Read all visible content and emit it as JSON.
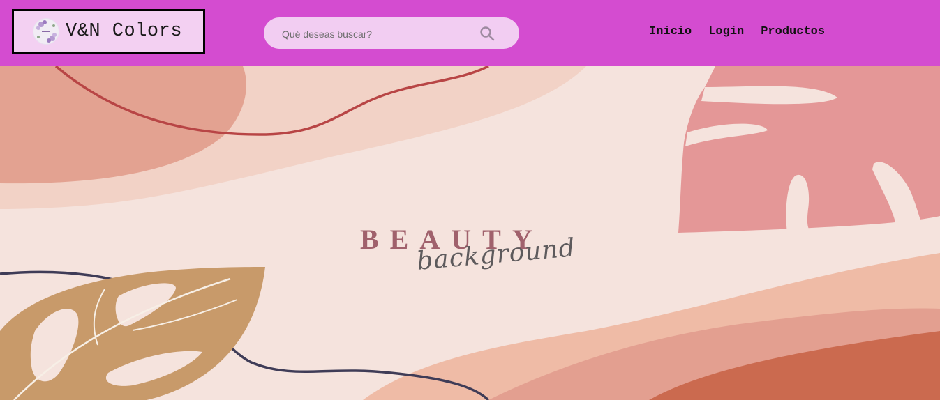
{
  "brand": {
    "name": "V&N Colors",
    "logo_icon": "flower-wreath-logo"
  },
  "search": {
    "placeholder": "Qué deseas buscar?",
    "icon": "search-icon"
  },
  "nav": {
    "items": [
      {
        "label": "Inicio"
      },
      {
        "label": "Login"
      },
      {
        "label": "Productos"
      }
    ]
  },
  "hero": {
    "title": "BEAUTY",
    "subtitle": "background"
  },
  "colors": {
    "navbar": "#d44cd0",
    "brand_bg": "#f3d0f2",
    "search_bg": "#f2cdf2",
    "hero_bg": "#f5e3dd",
    "title": "#a0616c"
  }
}
